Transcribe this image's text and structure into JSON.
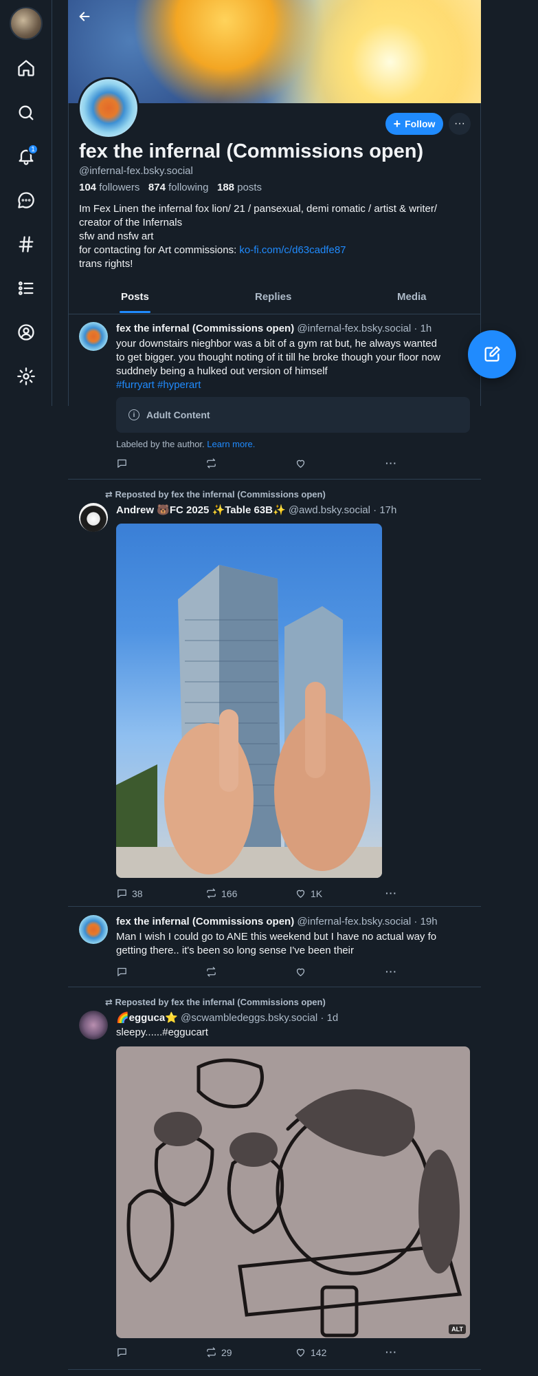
{
  "nav": {
    "notification_count": "1",
    "items": [
      "home-icon",
      "search-icon",
      "bell-icon",
      "chat-icon",
      "hashtag-icon",
      "lists-icon",
      "profile-icon",
      "gear-icon"
    ]
  },
  "profile": {
    "display_name": "fex the infernal (Commissions open)",
    "handle": "@infernal-fex.bsky.social",
    "followers_count": "104",
    "followers_label": "followers",
    "following_count": "874",
    "following_label": "following",
    "posts_count": "188",
    "posts_label": "posts",
    "follow_label": "Follow",
    "bio": {
      "line1": "Im Fex Linen the infernal fox lion/ 21 / pansexual, demi romatic / artist & writer/",
      "line2": "creator of the Infernals",
      "line3": "sfw and nsfw art",
      "line4_prefix": "for contacting for Art commissions: ",
      "line4_link": "ko-fi.com/c/d63cadfe87",
      "line5": "trans rights!"
    }
  },
  "tabs": {
    "posts": "Posts",
    "replies": "Replies",
    "media": "Media"
  },
  "posts": [
    {
      "author": "fex the infernal (Commissions open)",
      "handle": "@infernal-fex.bsky.social",
      "time": "· 1h",
      "line1": "your downstairs nieghbor was a bit of a gym rat but, he always wanted",
      "line2": "to get bigger. you thought noting of it till he broke though your floor now",
      "line3": "suddnely being a hulked out version of himself",
      "tags": "#furryart #hyperart",
      "adult_label": "Adult Content",
      "labeled_text": "Labeled by the author.",
      "learn_more": "Learn more."
    },
    {
      "repost_by": "Reposted by fex the infernal (Commissions open)",
      "author": "Andrew 🐻FC 2025 ✨Table 63B✨",
      "handle": "@awd.bsky.social",
      "time": "· 17h",
      "replies": "38",
      "reposts": "166",
      "likes": "1K"
    },
    {
      "author": "fex the infernal (Commissions open)",
      "handle": "@infernal-fex.bsky.social",
      "time": "· 19h",
      "line1": "Man I wish I could go to ANE this weekend but I have no actual way fo",
      "line2": "getting there.. it's been so long sense I've been their"
    },
    {
      "repost_by": "Reposted by fex the infernal (Commissions open)",
      "author": "🌈egguca⭐",
      "handle": "@scwambledeggs.bsky.social",
      "time": "· 1d",
      "text": "sleepy......#eggucart",
      "alt": "ALT",
      "reposts": "29",
      "likes": "142"
    }
  ]
}
